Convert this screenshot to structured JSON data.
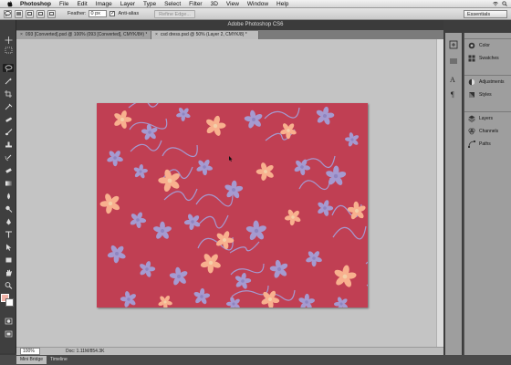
{
  "menubar": {
    "app_name": "Photoshop",
    "items": [
      "File",
      "Edit",
      "Image",
      "Layer",
      "Type",
      "Select",
      "Filter",
      "3D",
      "View",
      "Window",
      "Help"
    ],
    "window_title": "Adobe Photoshop CS6"
  },
  "options": {
    "feather_label": "Feather:",
    "feather_value": "0 px",
    "anti_alias_label": "Anti-alias",
    "refine_edge_label": "Refine Edge...",
    "workspace": "Essentials"
  },
  "tabs": [
    {
      "label": "093 [Converted].psd @ 100% (093 [Converted], CMYK/8#) *"
    },
    {
      "label": "csd dress.psd @ 50% (Layer 2, CMYK/8) *"
    }
  ],
  "status": {
    "zoom": "100%",
    "doc_info": "Doc: 1.11M/854.3K"
  },
  "bottom_tabs": [
    "Mini Bridge",
    "Timeline"
  ],
  "panels": {
    "group1": [
      "Color",
      "Swatches"
    ],
    "group2": [
      "Adjustments",
      "Styles"
    ],
    "group3": [
      "Layers",
      "Channels",
      "Paths"
    ]
  },
  "colors": {
    "canvas_bg": "#c03f53",
    "flower_peach": "#f8b08e",
    "flower_lavender": "#a59ad0",
    "foreground_swatch": "#f2b3a8"
  }
}
